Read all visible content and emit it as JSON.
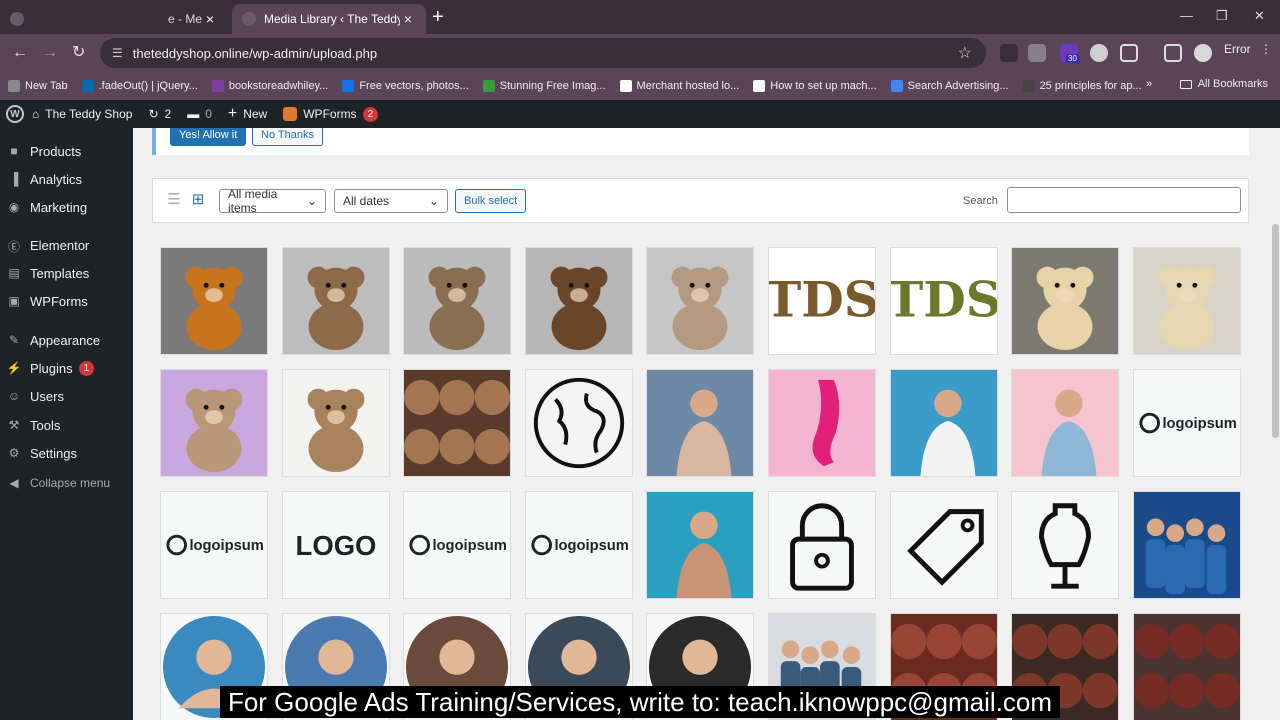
{
  "browser": {
    "tabs": [
      {
        "title": "e - Me",
        "active": false
      },
      {
        "title": "Media Library ‹ The Teddy Shop",
        "active": true
      }
    ],
    "url": "theteddyshop.online/wp-admin/upload.php",
    "profile_status": "Error",
    "extension_badge": "30",
    "bookmarks": [
      {
        "label": "New Tab",
        "color": "#888888"
      },
      {
        "label": ".fadeOut() | jQuery...",
        "color": "#0769ad"
      },
      {
        "label": "bookstoreadwhiley...",
        "color": "#7b3fa0"
      },
      {
        "label": "Free vectors, photos...",
        "color": "#1273eb"
      },
      {
        "label": "Stunning Free Imag...",
        "color": "#3d9a3d"
      },
      {
        "label": "Merchant hosted lo...",
        "color": "#ffffff"
      },
      {
        "label": "How to set up mach...",
        "color": "#ffffff"
      },
      {
        "label": "Search Advertising...",
        "color": "#4285f4"
      },
      {
        "label": "25 principles for ap...",
        "color": "#444444"
      }
    ],
    "all_bookmarks": "All Bookmarks"
  },
  "adminbar": {
    "site_name": "The Teddy Shop",
    "updates_count": "2",
    "comments_count": "0",
    "new_label": "New",
    "wpforms_label": "WPForms",
    "wpforms_badge": "2"
  },
  "sidebar": {
    "items": [
      {
        "label": "Products",
        "icon": "products-icon",
        "glyph": "■",
        "badge": ""
      },
      {
        "label": "Analytics",
        "icon": "analytics-icon",
        "glyph": "▐",
        "badge": ""
      },
      {
        "label": "Marketing",
        "icon": "marketing-icon",
        "glyph": "◉",
        "badge": ""
      },
      {
        "label": "Elementor",
        "icon": "elementor-icon",
        "glyph": "Ⓔ",
        "badge": ""
      },
      {
        "label": "Templates",
        "icon": "templates-icon",
        "glyph": "▤",
        "badge": ""
      },
      {
        "label": "WPForms",
        "icon": "wpforms-icon",
        "glyph": "▣",
        "badge": ""
      },
      {
        "label": "Appearance",
        "icon": "appearance-icon",
        "glyph": "✎",
        "badge": ""
      },
      {
        "label": "Plugins",
        "icon": "plugins-icon",
        "glyph": "⚡",
        "badge": "1"
      },
      {
        "label": "Users",
        "icon": "users-icon",
        "glyph": "☺",
        "badge": ""
      },
      {
        "label": "Tools",
        "icon": "tools-icon",
        "glyph": "⚒",
        "badge": ""
      },
      {
        "label": "Settings",
        "icon": "settings-icon",
        "glyph": "⚙",
        "badge": ""
      }
    ],
    "collapse_label": "Collapse menu"
  },
  "notice": {
    "allow_label": "Yes! Allow it",
    "decline_label": "No Thanks"
  },
  "media_toolbar": {
    "filter_type": "All media items",
    "filter_date": "All dates",
    "bulk_label": "Bulk select",
    "search_label": "Search",
    "search_value": ""
  },
  "media_items": [
    {
      "kind": "teddy",
      "name": "teddy-orange",
      "bg": "#7a7a7a",
      "fg": "#c8741f"
    },
    {
      "kind": "teddy",
      "name": "teddy-brown-grey",
      "bg": "#bdbdbd",
      "fg": "#8c6a4a"
    },
    {
      "kind": "teddy",
      "name": "teddy-beige",
      "bg": "#bcbcbc",
      "fg": "#8a6e52"
    },
    {
      "kind": "teddy",
      "name": "teddy-chocolate",
      "bg": "#b6b6b6",
      "fg": "#6b4528"
    },
    {
      "kind": "teddy",
      "name": "teddy-puppy",
      "bg": "#c6c6c6",
      "fg": "#b49a80"
    },
    {
      "kind": "text",
      "name": "tds-logo-1",
      "bg": "#ffffff",
      "fg": "#7a5a2a",
      "text": "TDS"
    },
    {
      "kind": "text",
      "name": "tds-logo-2",
      "bg": "#ffffff",
      "fg": "#6a7a2a",
      "text": "TDS"
    },
    {
      "kind": "teddy",
      "name": "teddy-wood-heart",
      "bg": "#7c7a70",
      "fg": "#e8d2a8"
    },
    {
      "kind": "teddy",
      "name": "teddy-wall",
      "bg": "#d8d4c8",
      "fg": "#e6d6b2"
    },
    {
      "kind": "teddy",
      "name": "teddy-party",
      "bg": "#c9a8e0",
      "fg": "#b89878"
    },
    {
      "kind": "teddy",
      "name": "teddy-white-bg",
      "bg": "#f2f2f0",
      "fg": "#a8825c"
    },
    {
      "kind": "pattern",
      "name": "teddy-pile",
      "bg": "#5a3a2a",
      "fg": "#b08058"
    },
    {
      "kind": "icon",
      "name": "globe-graphic",
      "bg": "#f4f4f4",
      "fg": "#111111"
    },
    {
      "kind": "person",
      "name": "woman-cap",
      "bg": "#6c8aa6",
      "fg": "#d8b8a0"
    },
    {
      "kind": "shoe",
      "name": "pink-heel",
      "bg": "#f3b4cf",
      "fg": "#e0207a"
    },
    {
      "kind": "person",
      "name": "man-tshirt",
      "bg": "#3a9cc8",
      "fg": "#f2f2f2"
    },
    {
      "kind": "person",
      "name": "woman-pink",
      "bg": "#f5c4cf",
      "fg": "#8fb8d8"
    },
    {
      "kind": "logo",
      "name": "logoipsum-1",
      "bg": "#f6f7f7",
      "fg": "#1d2327",
      "text": "logoipsum"
    },
    {
      "kind": "logo",
      "name": "logoipsum-2",
      "bg": "#f6f7f7",
      "fg": "#1d2327",
      "text": "logoipsum"
    },
    {
      "kind": "logobig",
      "name": "logo-wordmark",
      "bg": "#f6f7f7",
      "fg": "#1d2327",
      "text": "LOGO"
    },
    {
      "kind": "logo",
      "name": "logoipsum-3",
      "bg": "#f6f7f7",
      "fg": "#1d2327",
      "text": "logoipsum"
    },
    {
      "kind": "logo",
      "name": "logoipsum-4",
      "bg": "#f6f7f7",
      "fg": "#1d2327",
      "text": "logoipsum"
    },
    {
      "kind": "person",
      "name": "woman-teal",
      "bg": "#2aa0c0",
      "fg": "#c89478"
    },
    {
      "kind": "icon",
      "name": "lock-graphic",
      "bg": "#f6f7f7",
      "fg": "#111111"
    },
    {
      "kind": "icon",
      "name": "tag-graphic",
      "bg": "#f6f7f7",
      "fg": "#111111"
    },
    {
      "kind": "icon",
      "name": "mannequin-graphic",
      "bg": "#f6f7f7",
      "fg": "#111111"
    },
    {
      "kind": "group",
      "name": "friends-denim",
      "bg": "#1a4a8a",
      "fg": "#2a6ab0"
    },
    {
      "kind": "avatar",
      "name": "avatar-woman-1",
      "bg": "#f6f7f7",
      "fg": "#3a8ac0"
    },
    {
      "kind": "avatar",
      "name": "avatar-man-beard",
      "bg": "#f6f7f7",
      "fg": "#4a7ab0"
    },
    {
      "kind": "avatar",
      "name": "avatar-woman-2",
      "bg": "#f6f7f7",
      "fg": "#6a4a3a"
    },
    {
      "kind": "avatar",
      "name": "avatar-woman-3",
      "bg": "#f6f7f7",
      "fg": "#3a4a5a"
    },
    {
      "kind": "avatar",
      "name": "avatar-man-suit",
      "bg": "#f6f7f7",
      "fg": "#2a2a2a"
    },
    {
      "kind": "group",
      "name": "team-photo",
      "bg": "#d8dce0",
      "fg": "#3a5a7a"
    },
    {
      "kind": "pattern",
      "name": "red-sweaters",
      "bg": "#6a2a22",
      "fg": "#a04a3a"
    },
    {
      "kind": "pattern",
      "name": "leather-items",
      "bg": "#3a2a22",
      "fg": "#8a3a2a"
    },
    {
      "kind": "pattern",
      "name": "boots",
      "bg": "#4a3430",
      "fg": "#7a2a22"
    }
  ],
  "caption": "For Google Ads Training/Services, write to: teach.iknowppc@gmail.com"
}
